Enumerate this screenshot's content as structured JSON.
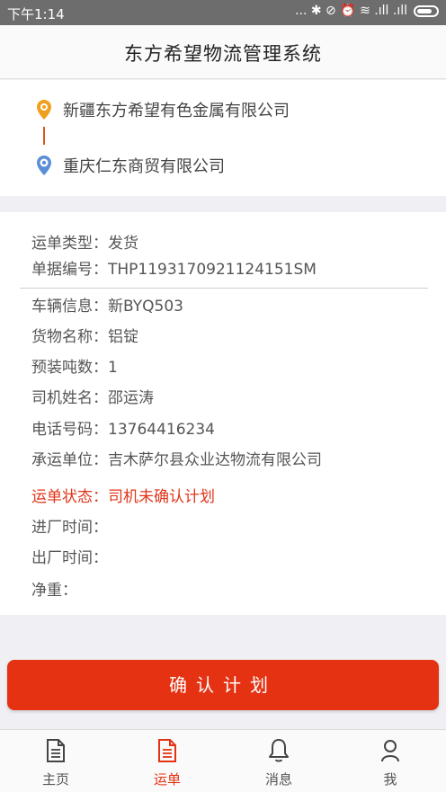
{
  "status_bar": {
    "time": "下午1:14",
    "icons_text": "... ✱ ⊘ ⏰ ≋ .ıll .ıll"
  },
  "header": {
    "title": "东方希望物流管理系统"
  },
  "route": {
    "from": "新疆东方希望有色金属有限公司",
    "to": "重庆仁东商贸有限公司",
    "accent": "#e0531a"
  },
  "details": {
    "type": {
      "label": "运单类型：",
      "value": "发货"
    },
    "doc_no": {
      "label": "单据编号：",
      "value": "THP1193170921124151SM"
    },
    "vehicle": {
      "label": "车辆信息：",
      "value": "新BYQ503"
    },
    "goods": {
      "label": "货物名称：",
      "value": "铝锭"
    },
    "tons": {
      "label": "预装吨数：",
      "value": "1"
    },
    "driver": {
      "label": "司机姓名：",
      "value": "邵运涛"
    },
    "phone": {
      "label": "电话号码：",
      "value": "13764416234"
    },
    "carrier": {
      "label": "承运单位：",
      "value": "吉木萨尔县众业达物流有限公司"
    },
    "status": {
      "label": "运单状态：",
      "value": "司机未确认计划",
      "color": "#e0351a"
    },
    "entry_time": {
      "label": "进厂时间：",
      "value": ""
    },
    "exit_time": {
      "label": "出厂时间：",
      "value": ""
    },
    "net_weight": {
      "label": "净重：",
      "value": ""
    }
  },
  "confirm_button": {
    "label": "确认计划",
    "color": "#e43212"
  },
  "tabs": [
    {
      "label": "主页",
      "icon": "document-icon",
      "active": false
    },
    {
      "label": "运单",
      "icon": "document-icon",
      "active": true
    },
    {
      "label": "消息",
      "icon": "bell-icon",
      "active": false
    },
    {
      "label": "我",
      "icon": "person-icon",
      "active": false
    }
  ]
}
